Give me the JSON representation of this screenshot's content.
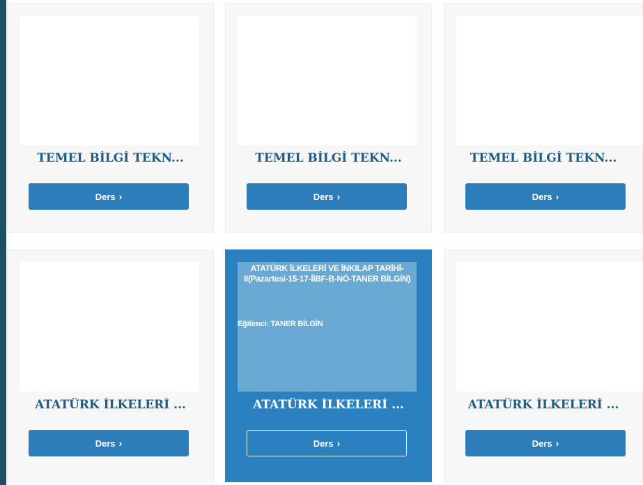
{
  "courses": [
    {
      "title": "TEMEL BİLGİ TEKN...",
      "button_label": "Ders"
    },
    {
      "title": "TEMEL BİLGİ TEKN...",
      "button_label": "Ders"
    },
    {
      "title": "TEMEL BİLGİ TEKN...",
      "button_label": "Ders"
    },
    {
      "title": "ATATÜRK İLKELERİ ...",
      "button_label": "Ders"
    },
    {
      "title": "ATATÜRK İLKELERİ ...",
      "button_label": "Ders",
      "hover_title": "ATATÜRK İLKELERİ VE İNKILAP TARİHİ-II(Pazartesi-15-17-İİBF-B-NÖ-TANER BİLGİN)",
      "hover_instructor": "Eğitimci: TANER BİLGİN"
    },
    {
      "title": "ATATÜRK İLKELERİ ...",
      "button_label": "Ders"
    }
  ],
  "icons": {
    "button_icon": "chevron-right-icon"
  },
  "colors": {
    "accent": "#2d7dbb",
    "title": "#1e5c86",
    "active_card": "#2b80bf",
    "active_thumb": "#69a9d2",
    "card_bg": "#f7f7f7",
    "sidebar_edge": "#1f4f63"
  }
}
